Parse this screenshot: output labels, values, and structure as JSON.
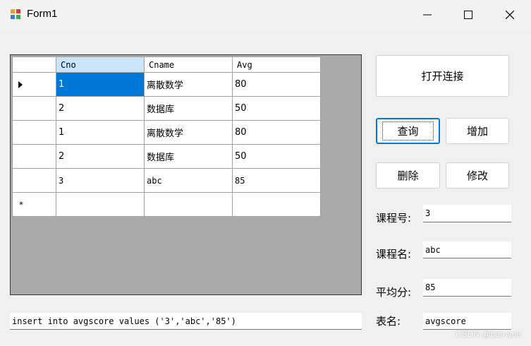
{
  "window": {
    "title": "Form1"
  },
  "grid": {
    "columns": [
      "Cno",
      "Cname",
      "Avg"
    ],
    "rows": [
      [
        "1",
        "离散数学",
        "80"
      ],
      [
        "2",
        "数据库",
        "50"
      ],
      [
        "1",
        "离散数学",
        "80"
      ],
      [
        "2",
        "数据库",
        "50"
      ],
      [
        "3",
        "abc",
        "85"
      ]
    ],
    "new_row_marker": "*"
  },
  "buttons": {
    "connect": "打开连接",
    "query": "查询",
    "add": "增加",
    "delete": "删除",
    "modify": "修改"
  },
  "fields": {
    "course_no_label": "课程号:",
    "course_no_value": "3",
    "course_name_label": "课程名:",
    "course_name_value": "abc",
    "avg_label": "平均分:",
    "avg_value": "85",
    "table_label": "表名:",
    "table_value": "avgscore",
    "sql_value": "insert into avgscore values ('3','abc','85')"
  },
  "watermark": "CSDN @ban-yue",
  "colors": {
    "selection": "#0078d7",
    "header_selected": "#cce4f7",
    "grid_bg": "#ababab"
  }
}
